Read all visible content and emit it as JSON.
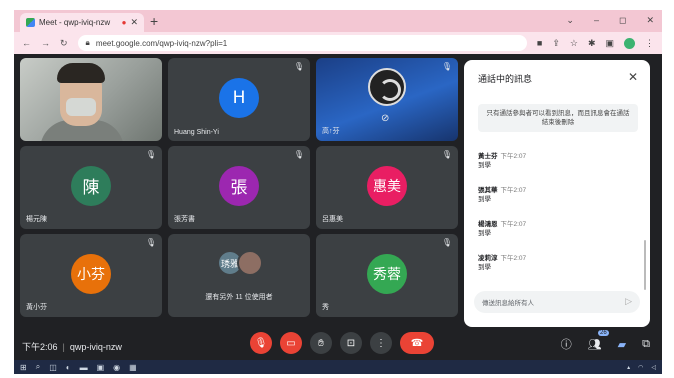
{
  "browser": {
    "tab_title": "Meet - qwp-iviq-nzw",
    "recording_dot": "●",
    "close": "✕",
    "new_tab": "+",
    "url": "meet.google.com/qwp-iviq-nzw?pli=1",
    "window_controls": [
      "⌄",
      "–",
      "◻",
      "✕"
    ]
  },
  "tiles": [
    {
      "name": "",
      "type": "video",
      "muted": false
    },
    {
      "name": "Huang Shin-Yi",
      "initial": "H",
      "color": "#1a73e8",
      "muted": true
    },
    {
      "name": "高↑芬",
      "type": "obs",
      "muted": true
    },
    {
      "name": "楊元陳",
      "initial": "陳",
      "color": "#2e7d5b",
      "muted": true
    },
    {
      "name": "張芳書",
      "initial": "張",
      "color": "#9c27b0",
      "muted": true
    },
    {
      "name": "呂惠美",
      "initial": "惠美",
      "color": "#e91e63",
      "muted": true
    },
    {
      "name": "黃小芬",
      "initial": "小芬",
      "color": "#e8710a",
      "muted": true
    },
    {
      "name": "",
      "type": "group",
      "group_label": "還有另外 11 位使用者",
      "avatars": [
        {
          "text": "琇雅",
          "color": "#607d8b"
        },
        {
          "text": "",
          "color": "#8d6e63"
        }
      ]
    },
    {
      "name": "秀",
      "initial": "秀蓉",
      "color": "#34a853",
      "muted": true
    }
  ],
  "chat": {
    "title": "通話中的訊息",
    "note": "只有通話參與者可以看到訊息，而且訊息會在通話結束後刪除",
    "messages": [
      {
        "who": "黃士芬",
        "time": "下午2:07",
        "text": "到學"
      },
      {
        "who": "張其華",
        "time": "下午2:07",
        "text": "到學"
      },
      {
        "who": "楊鴻恩",
        "time": "下午2:07",
        "text": "到學"
      },
      {
        "who": "凌莉淳",
        "time": "下午2:07",
        "text": "到學"
      }
    ],
    "input_placeholder": "傳送訊息給所有人",
    "send_icon": "▷"
  },
  "bottom": {
    "time": "下午2:06",
    "meeting_code": "qwp-iviq-nzw",
    "participants_count": "26"
  }
}
